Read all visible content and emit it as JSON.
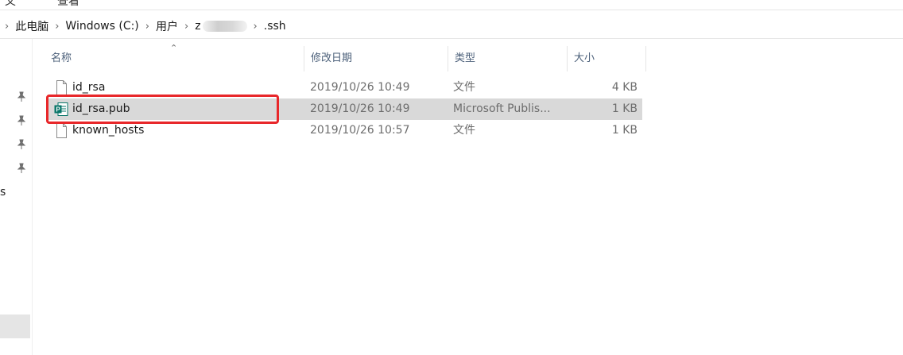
{
  "ribbon": {
    "left_text": "文",
    "view_tab": "查看"
  },
  "address": {
    "crumbs": [
      "此电脑",
      "Windows (C:)",
      "用户",
      "z",
      ".ssh"
    ]
  },
  "nav": {
    "partial_label": "s"
  },
  "columns": {
    "name": "名称",
    "date": "修改日期",
    "type": "类型",
    "size": "大小"
  },
  "files": [
    {
      "name": "id_rsa",
      "date": "2019/10/26 10:49",
      "type": "文件",
      "size": "4 KB",
      "icon": "blank-file-icon"
    },
    {
      "name": "id_rsa.pub",
      "date": "2019/10/26 10:49",
      "type": "Microsoft Publis...",
      "size": "1 KB",
      "icon": "publisher-file-icon"
    },
    {
      "name": "known_hosts",
      "date": "2019/10/26 10:57",
      "type": "文件",
      "size": "1 KB",
      "icon": "blank-file-icon"
    }
  ],
  "colors": {
    "highlight": "#e8272a",
    "selected_row": "#d9d9d9",
    "publisher_green": "#077568"
  }
}
